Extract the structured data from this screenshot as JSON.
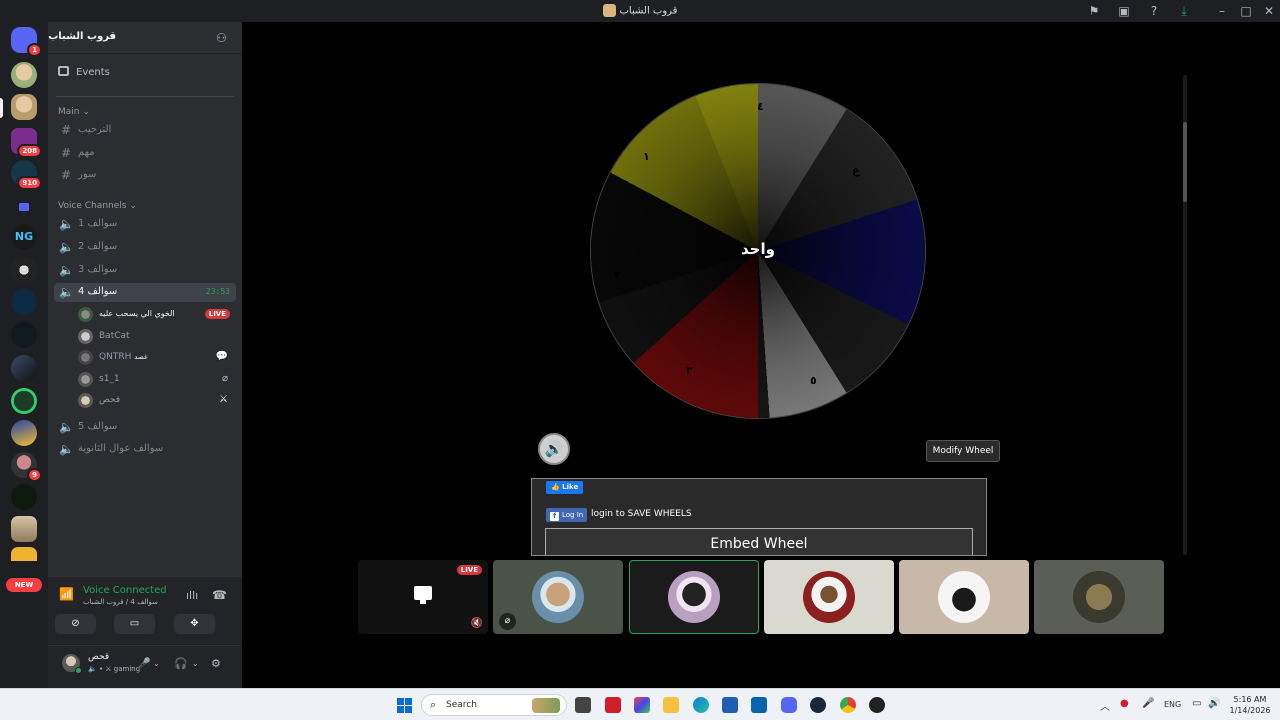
{
  "window": {
    "title": "قروب الشباب"
  },
  "rail": {
    "home_badge": "1",
    "badges": {
      "s3": "208",
      "s4": "910",
      "s13": "9"
    },
    "new_label": "NEW"
  },
  "guild": {
    "name": "قروب الشباب",
    "events_label": "Events",
    "categories": {
      "main": "Main",
      "voice": "Voice Channels"
    },
    "text_channels": [
      "الترحيب",
      "مهم",
      "سور"
    ],
    "voice_channels": [
      "سوالف 1",
      "سوالف 2",
      "سوالف 3",
      "سوالف 4",
      "سوالف 5",
      "سوالف عوال الثانوية"
    ],
    "active_timer": "23:53",
    "voice_users": [
      {
        "name": "الخوي الي يسحب عليه",
        "live": "LIVE"
      },
      {
        "name": "BatCat"
      },
      {
        "name": "QNTRH",
        "tag": "غصد"
      },
      {
        "name": "s1_1"
      },
      {
        "name": "قحص"
      }
    ]
  },
  "voice_panel": {
    "status": "Voice Connected",
    "location": "سوالف 4 / قروب الشباب"
  },
  "user": {
    "name": "قحص",
    "status": "gaming"
  },
  "stage": {
    "wheel_center": "واحد",
    "wheel_labels": [
      "٤",
      "ع",
      "٥",
      "٣",
      "٢",
      "١"
    ],
    "modify_button": "Modify Wheel",
    "fb_like": "Like",
    "fb_login": "Log In",
    "login_text": "login to SAVE WHEELS",
    "embed_button": "Embed Wheel",
    "tile_live": "LIVE"
  },
  "taskbar": {
    "search_placeholder": "Search",
    "lang": "ENG",
    "time": "5:16 AM",
    "date": "1/14/2026"
  },
  "colors": {
    "accent_green": "#23a55a",
    "live_red": "#da373c",
    "blurple": "#5865f2"
  }
}
